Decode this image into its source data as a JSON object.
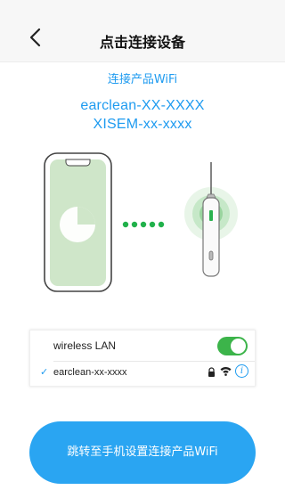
{
  "header": {
    "title": "点击连接设备",
    "back_icon": "chevron-left-icon"
  },
  "main": {
    "subtitle": "连接产品WiFi",
    "ssid_line1": "earclean-XX-XXXX",
    "ssid_line2": "XISEM-xx-xxxx"
  },
  "wifi_settings": {
    "label": "wireless LAN",
    "enabled": true,
    "selected_network": "earclean-xx-xxxx",
    "info_symbol": "i"
  },
  "cta": {
    "label": "跳转至手机设置连接产品WiFi"
  },
  "colors": {
    "accent": "#1e9bf0",
    "button": "#2aa5f2",
    "toggle_on": "#3cb44a",
    "dots": "#21b14b"
  }
}
